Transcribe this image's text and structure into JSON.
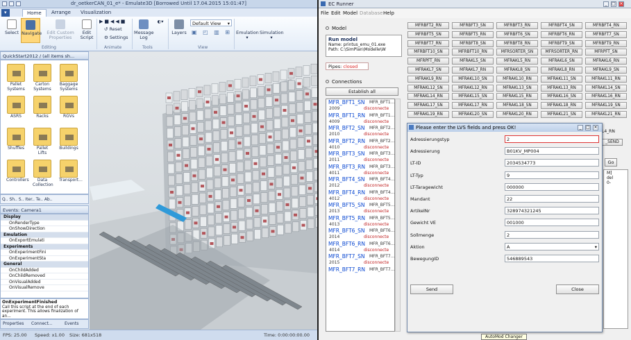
{
  "left": {
    "title": "dr_oetkerCAN_01_e* - Emulate3D [Borrowed Until 17.04.2015 15:01:47]",
    "ribbon_tabs": [
      "Home",
      "Arrange",
      "Visualization"
    ],
    "ribbon_buttons": {
      "select": "Select",
      "navigate": "Navigate",
      "edit_props": "Edit Custom Properties",
      "edit_script": "Edit Script",
      "reset": "Reset",
      "settings": "Settings",
      "message_log": "Message Log",
      "layers": "Layers",
      "view_select": "Default View",
      "emulation": "Emulation",
      "simulation": "Simulation"
    },
    "ribbon_groups": [
      "Editing",
      "Animate",
      "Tools",
      "View"
    ],
    "palette": {
      "title": "QuickStart2012 / (all items sh...",
      "items": [
        "Pallet Systems",
        "Carton Systems",
        "Baggage Systems",
        "ASRS",
        "Racks",
        "RGVs",
        "Shuffles",
        "Pallet Lifts",
        "Buildings",
        "Controllers",
        "Data Collection",
        "Transport..."
      ],
      "bottom_tabs": "Q..  Sh..  S..  Iter..  Te..  Ab.."
    },
    "events": {
      "title": "Events: Camera1",
      "rows": [
        {
          "cat": true,
          "text": "Display"
        },
        {
          "cat": false,
          "text": "OnRenderType"
        },
        {
          "cat": false,
          "text": "OnShowDirection"
        },
        {
          "cat": true,
          "text": "Emulation"
        },
        {
          "cat": false,
          "text": "OnExportEmulati"
        },
        {
          "cat": true,
          "text": "Experiments"
        },
        {
          "cat": false,
          "text": "OnExperimentFini"
        },
        {
          "cat": false,
          "text": "OnExperimentSta"
        },
        {
          "cat": true,
          "text": "General"
        },
        {
          "cat": false,
          "text": "OnChildAdded"
        },
        {
          "cat": false,
          "text": "OnChildRemoved"
        },
        {
          "cat": false,
          "text": "OnVisualAdded"
        },
        {
          "cat": false,
          "text": "OnVisualRemove"
        }
      ],
      "desc_title": "OnExperimentFinished",
      "desc_text": "Call this script at the end of each experiment. This allows finalization of an...",
      "tabs": [
        "Properties",
        "Connect...",
        "Events"
      ]
    },
    "status": {
      "fps": "FPS: 25.00",
      "speed": "Speed: x1.00",
      "size": "Size: 681x518",
      "time": "Time: 0:00:00:00.00"
    }
  },
  "right": {
    "title": "EC Runner",
    "menu": [
      "File",
      "Edit",
      "Model",
      "Database",
      "Help"
    ],
    "model_section": "Model",
    "run_model": {
      "title": "Run model",
      "name_label": "Name:",
      "name": "printus_emu_01.exe",
      "path_label": "Path:",
      "path": "C:\\SimPlan\\Modelle\\W"
    },
    "pipes_label": "Pipes:",
    "pipes_status": "closed",
    "connections_section": "Connections",
    "establish_all": "Establish all",
    "connections": [
      {
        "name": "MFR_BFT1_SN",
        "mfr": "MFR_BFT1...",
        "port": "2009",
        "status": "disconnecte"
      },
      {
        "name": "MFR_BFT1_RN",
        "mfr": "MFR_BFT1...",
        "port": "4009",
        "status": "disconnecte"
      },
      {
        "name": "MFR_BFT2_SN",
        "mfr": "MFR_BFT2...",
        "port": "2010",
        "status": "disconnecte"
      },
      {
        "name": "MFR_BFT2_RN",
        "mfr": "MFR_BFT2...",
        "port": "4010",
        "status": "disconnecte"
      },
      {
        "name": "MFR_BFT3_SN",
        "mfr": "MFR_BFT3...",
        "port": "2011",
        "status": "disconnecte"
      },
      {
        "name": "MFR_BFT3_RN",
        "mfr": "MFR_BFT3...",
        "port": "4011",
        "status": "disconnecte"
      },
      {
        "name": "MFR_BFT4_SN",
        "mfr": "MFR_BFT4...",
        "port": "2012",
        "status": "disconnecte"
      },
      {
        "name": "MFR_BFT4_RN",
        "mfr": "MFR_BFT4...",
        "port": "4012",
        "status": "disconnecte"
      },
      {
        "name": "MFR_BFT5_SN",
        "mfr": "MFR_BFT5...",
        "port": "2013",
        "status": "disconnecte"
      },
      {
        "name": "MFR_BFT5_RN",
        "mfr": "MFR_BFT5...",
        "port": "4013",
        "status": "disconnecte"
      },
      {
        "name": "MFR_BFT6_SN",
        "mfr": "MFR_BFT6...",
        "port": "2014",
        "status": "disconnecte"
      },
      {
        "name": "MFR_BFT6_RN",
        "mfr": "MFR_BFT6...",
        "port": "4014",
        "status": "disconnecte"
      },
      {
        "name": "MFR_BFT7_SN",
        "mfr": "MFR_BFT7...",
        "port": "2015",
        "status": "disconnecte"
      },
      {
        "name": "MFR_BFT7_RN",
        "mfr": "MFR_BFT7...",
        "port": "",
        "status": ""
      }
    ],
    "grid_buttons": [
      [
        "MFRBFT2_RN",
        "MFRBFT3_SN",
        "MFRBFT3_RN",
        "MFRBFT4_SN",
        "MFRBFT4_RN"
      ],
      [
        "MFRBFT5_SN",
        "MFRBFT5_RN",
        "MFRBFT6_SN",
        "MFRBFT6_RN",
        "MFRBFT7_SN"
      ],
      [
        "MFRBFT7_RN",
        "MFRBFT8_SN",
        "MFRBFT8_RN",
        "MFRBFT9_SN",
        "MFRBFT9_RN"
      ],
      [
        "MFRBFT10_SN",
        "MFRBFT10_RN",
        "MFRSORTER_SN",
        "MFRSORTER_RN",
        "MFRPFT_SN"
      ],
      [
        "MFRPFT_RN",
        "MFRAKL5_SN",
        "MFRAKL5_RN",
        "MFRAKL6_SN",
        "MFRAKL6_RN"
      ],
      [
        "MFRAKL7_SN",
        "MFRAKL7_RN",
        "MFRAKL8_SN",
        "MFRAKL8_RN",
        "MFRAKL9_SN"
      ],
      [
        "MFRAKL9_RN",
        "MFRAKL10_SN",
        "MFRAKL10_RN",
        "MFRAKL11_SN",
        "MFRAKL11_RN"
      ],
      [
        "MFRAKL12_SN",
        "MFRAKL12_RN",
        "MFRAKL13_SN",
        "MFRAKL13_RN",
        "MFRAKL14_SN"
      ],
      [
        "MFRAKL14_RN",
        "MFRAKL15_SN",
        "MFRAKL15_RN",
        "MFRAKL16_SN",
        "MFRAKL16_RN"
      ],
      [
        "MFRAKL17_SN",
        "MFRAKL17_RN",
        "MFRAKL18_SN",
        "MFRAKL18_RN",
        "MFRAKL19_SN"
      ],
      [
        "MFRAKL19_RN",
        "MFRAKL20_SN",
        "MFRAKL20_RN",
        "MFRAKL21_SN",
        "MFRAKL21_RN"
      ]
    ],
    "side_fragments": [
      "L4_RN",
      "_SEND",
      "Go",
      "M]",
      "del",
      "0-"
    ],
    "dialog": {
      "title": "Please enter the LVS fields and press OK!",
      "fields": [
        {
          "label": "Adressierungstyp",
          "value": "2"
        },
        {
          "label": "Adressierung",
          "value": "B01KV_MP004"
        },
        {
          "label": "LT-ID",
          "value": "2034534773"
        },
        {
          "label": "LT-Typ",
          "value": "9"
        },
        {
          "label": "LT-Taragewicht",
          "value": "000000"
        },
        {
          "label": "Mandant",
          "value": "22"
        },
        {
          "label": "ArtikelNr",
          "value": "328974321245"
        },
        {
          "label": "Gewicht VE",
          "value": "001000"
        },
        {
          "label": "Sollmenge",
          "value": "2"
        },
        {
          "label": "Aktion",
          "value": "A"
        },
        {
          "label": "BewegungID",
          "value": "546889543"
        }
      ],
      "send": "Send",
      "close": "Close"
    },
    "tooltip": "AutoMod Changer"
  },
  "colors": {
    "link_blue": "#0645d1",
    "status_red": "#c02020",
    "ribbon_bg": "#dde6f2"
  }
}
